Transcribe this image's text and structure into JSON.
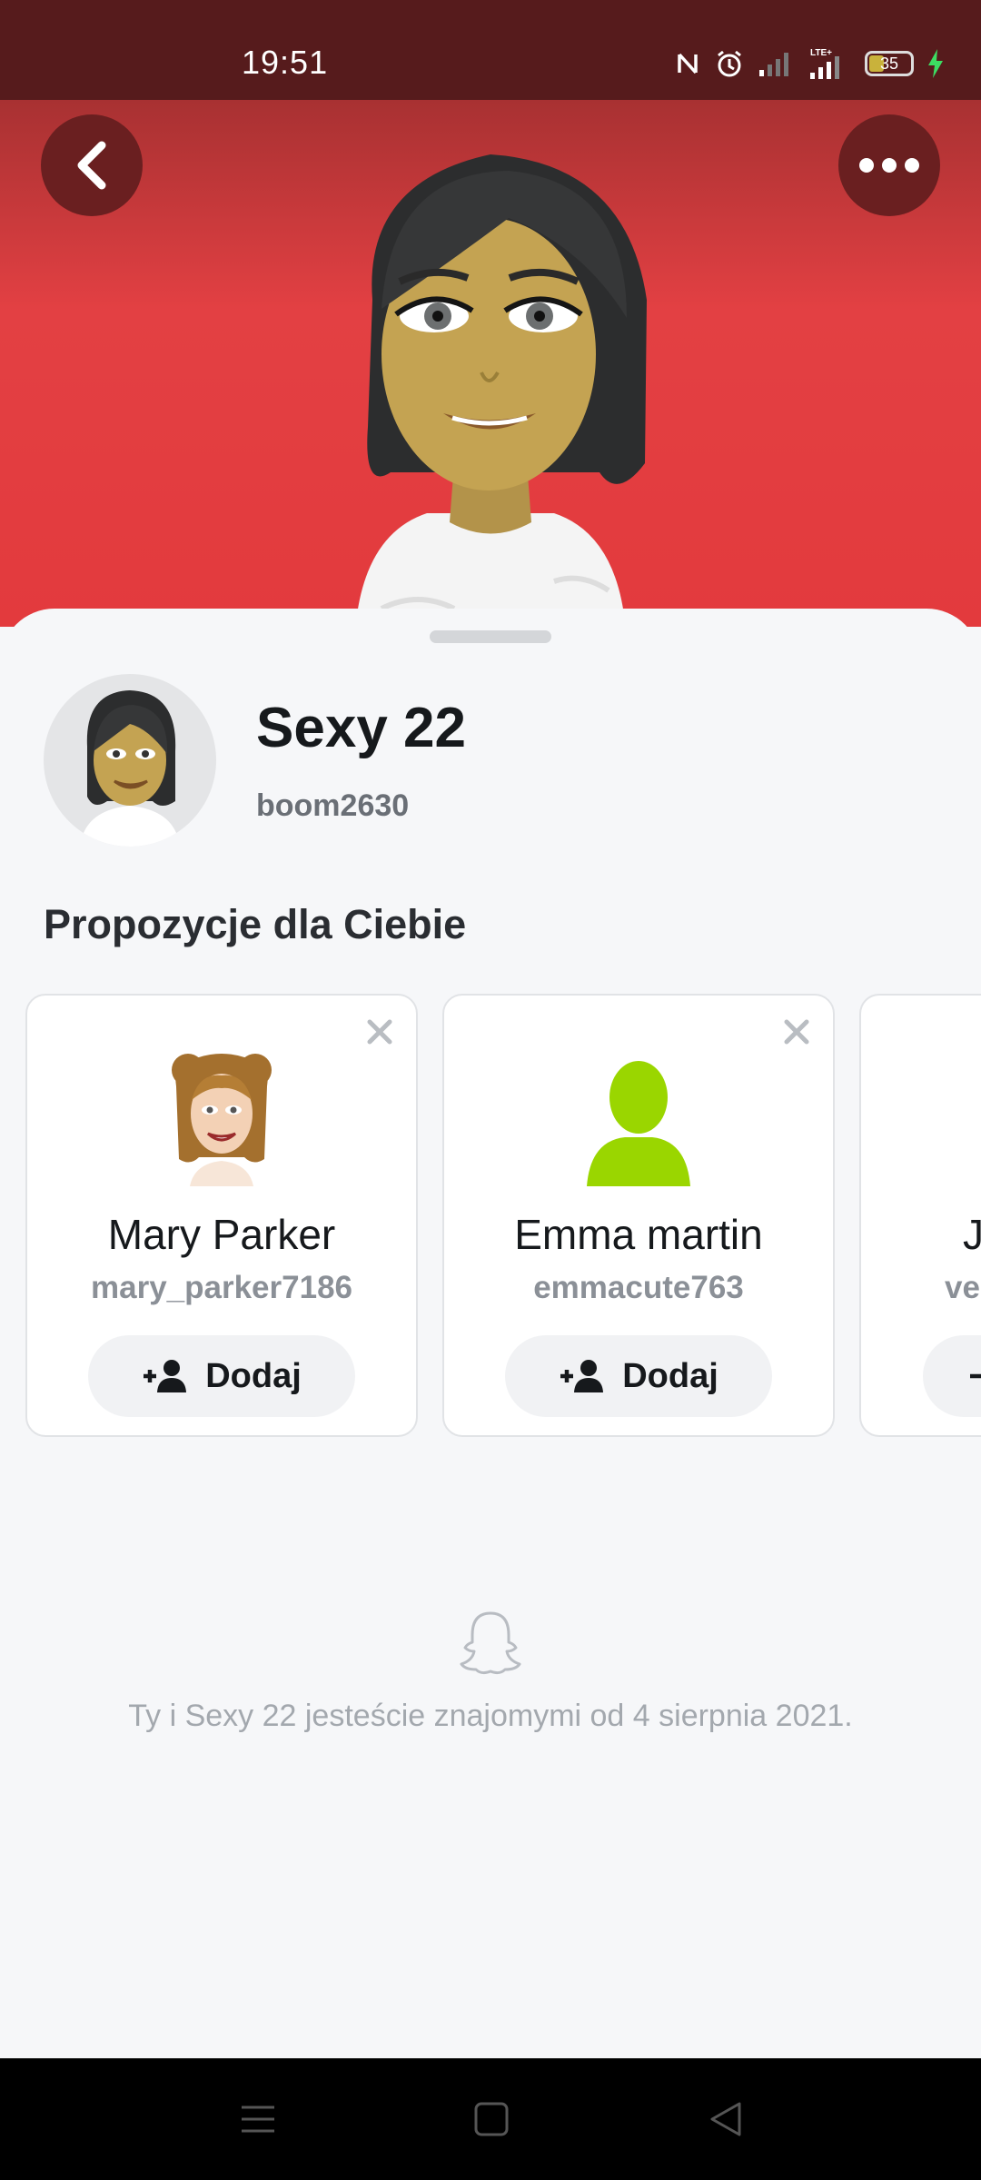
{
  "status_bar": {
    "time": "19:51",
    "network_label": "LTE+",
    "battery_level": "35",
    "icons": [
      "nfc-icon",
      "alarm-icon",
      "signal-icon",
      "lte-signal-icon",
      "battery-icon",
      "charging-icon"
    ]
  },
  "header": {
    "back_icon": "chevron-left-icon",
    "more_icon": "more-horizontal-icon"
  },
  "profile": {
    "display_name": "Sexy 22",
    "username": "boom2630"
  },
  "suggestions": {
    "title": "Propozycje dla Ciebie",
    "cards": [
      {
        "name": "Mary Parker",
        "username": "mary_parker7186",
        "add_label": "Dodaj"
      },
      {
        "name": "Emma martin",
        "username": "emmacute763",
        "add_label": "Dodaj"
      },
      {
        "name": "J",
        "username": "ve",
        "add_label": ""
      }
    ]
  },
  "footer": {
    "friends_since": "Ty i Sexy 22 jesteście znajomymi od 4 sierpnia 2021."
  },
  "colors": {
    "hero": "#e33a3d",
    "status_bar": "#561b1c",
    "placeholder_avatar": "#9ad600"
  }
}
